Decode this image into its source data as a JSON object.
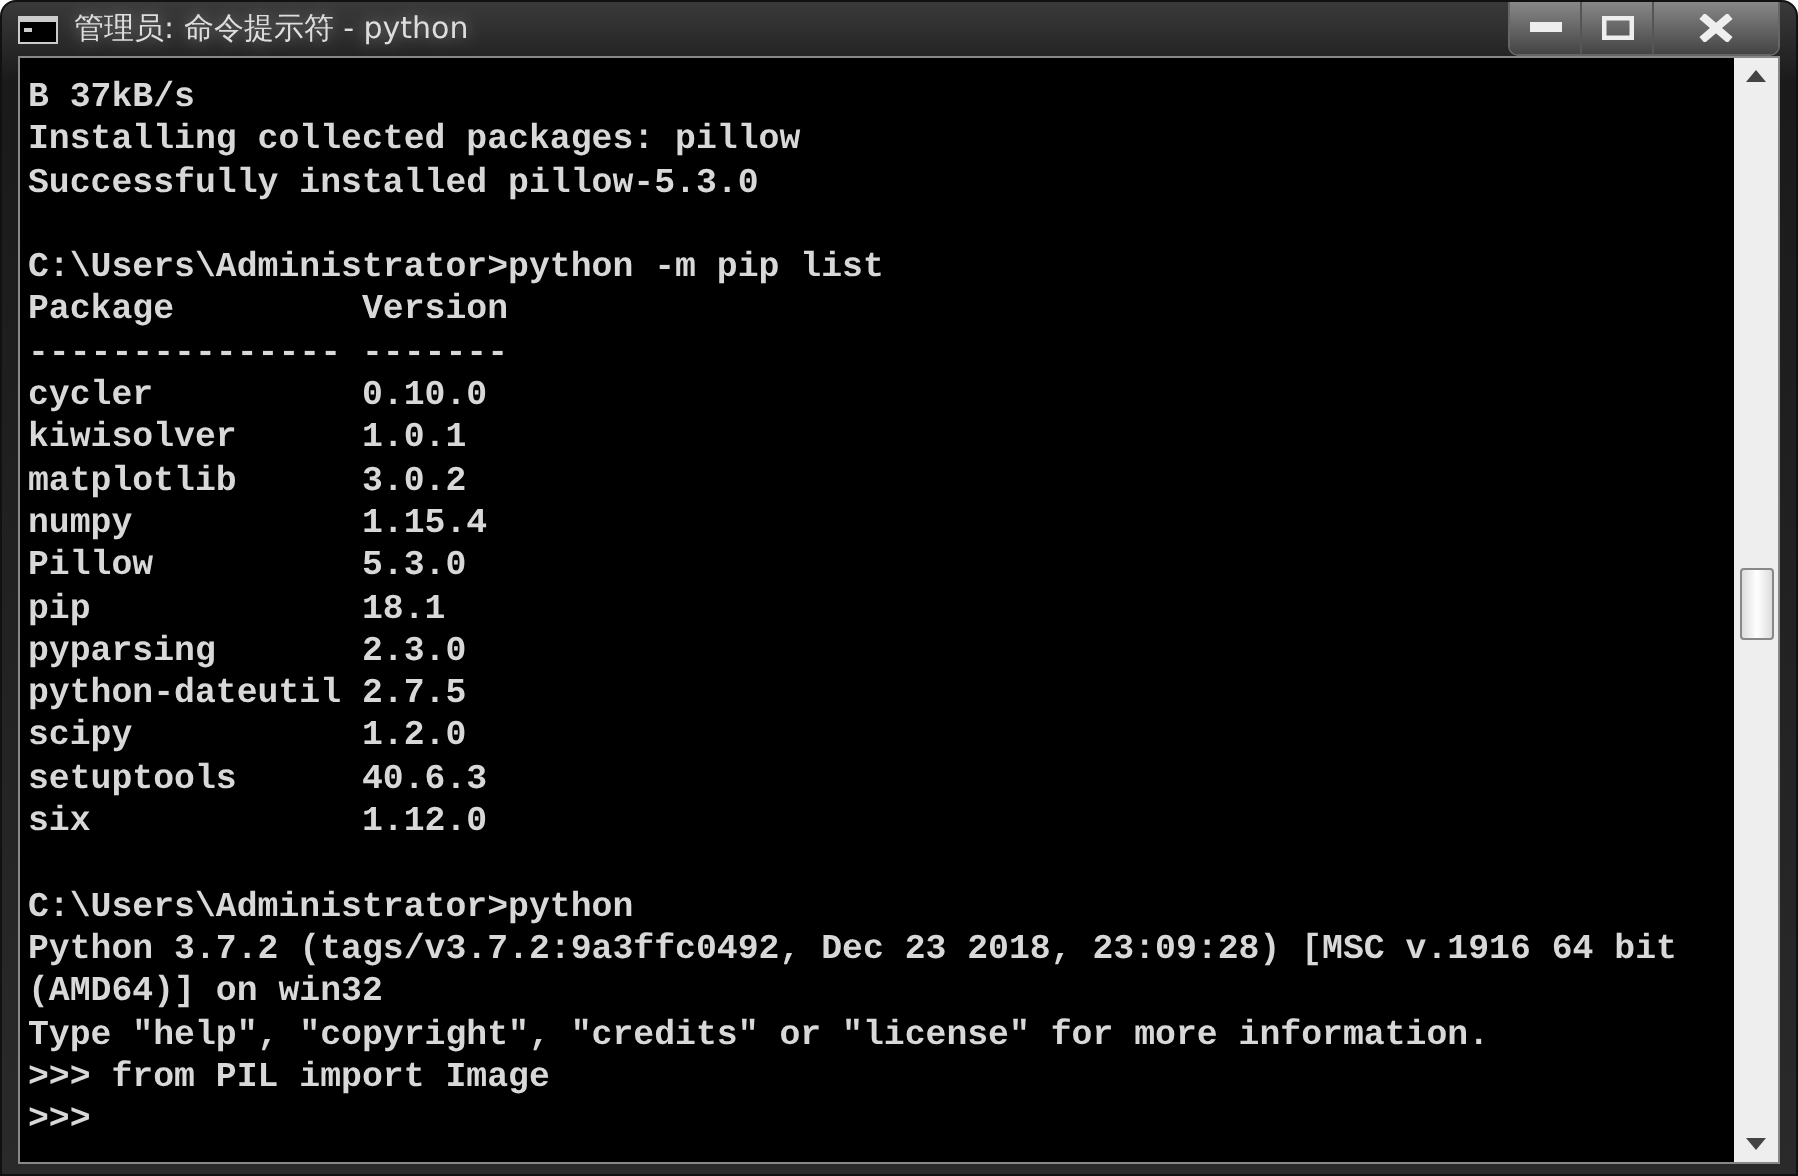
{
  "window": {
    "title": "管理员: 命令提示符 - python"
  },
  "console": {
    "blocks": [
      [
        "B 37kB/s",
        "Installing collected packages: pillow",
        "Successfully installed pillow-5.3.0"
      ],
      [
        "C:\\Users\\Administrator>python -m pip list",
        "Package         Version",
        "--------------- -------",
        "cycler          0.10.0",
        "kiwisolver      1.0.1",
        "matplotlib      3.0.2",
        "numpy           1.15.4",
        "Pillow          5.3.0",
        "pip             18.1",
        "pyparsing       2.3.0",
        "python-dateutil 2.7.5",
        "scipy           1.2.0",
        "setuptools      40.6.3",
        "six             1.12.0"
      ],
      [
        "C:\\Users\\Administrator>python",
        "Python 3.7.2 (tags/v3.7.2:9a3ffc0492, Dec 23 2018, 23:09:28) [MSC v.1916 64 bit",
        "(AMD64)] on win32",
        "Type \"help\", \"copyright\", \"credits\" or \"license\" for more information.",
        ">>> from PIL import Image",
        ">>>"
      ]
    ]
  }
}
